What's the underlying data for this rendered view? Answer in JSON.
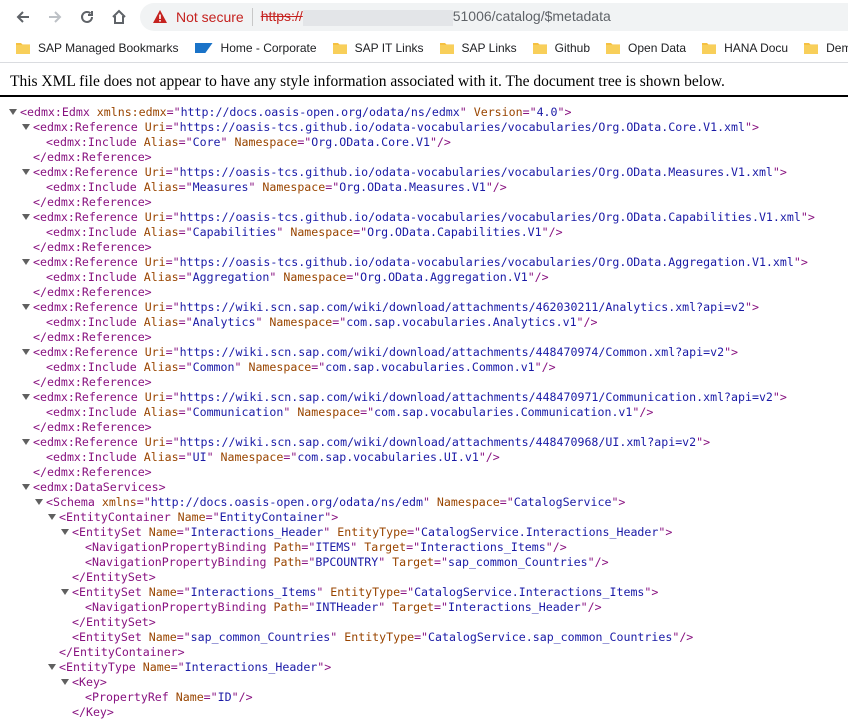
{
  "toolbar": {
    "not_secure": "Not secure",
    "url_scheme": "https://",
    "url_rest": "51006/catalog/$metadata"
  },
  "bookmarks": [
    {
      "label": "SAP Managed Bookmarks",
      "icon": "folder-icon"
    },
    {
      "label": "Home - Corporate",
      "icon": "sap-logo-icon"
    },
    {
      "label": "SAP IT Links",
      "icon": "folder-icon"
    },
    {
      "label": "SAP Links",
      "icon": "folder-icon"
    },
    {
      "label": "Github",
      "icon": "folder-icon"
    },
    {
      "label": "Open Data",
      "icon": "folder-icon"
    },
    {
      "label": "HANA Docu",
      "icon": "folder-icon"
    },
    {
      "label": "Dem",
      "icon": "folder-icon"
    }
  ],
  "notice": "This XML file does not appear to have any style information associated with it. The document tree is shown below.",
  "xml_lines": [
    {
      "i": 0,
      "t": true,
      "p": [
        [
          "tag",
          "<edmx:Edmx "
        ],
        [
          "attr",
          "xmlns:edmx"
        ],
        [
          "tag",
          "=\""
        ],
        [
          "val",
          "http://docs.oasis-open.org/odata/ns/edmx"
        ],
        [
          "tag",
          "\" "
        ],
        [
          "attr",
          "Version"
        ],
        [
          "tag",
          "=\""
        ],
        [
          "val",
          "4.0"
        ],
        [
          "tag",
          "\">"
        ]
      ]
    },
    {
      "i": 1,
      "t": true,
      "p": [
        [
          "tag",
          "<edmx:Reference "
        ],
        [
          "attr",
          "Uri"
        ],
        [
          "tag",
          "=\""
        ],
        [
          "val",
          "https://oasis-tcs.github.io/odata-vocabularies/vocabularies/Org.OData.Core.V1.xml"
        ],
        [
          "tag",
          "\">"
        ]
      ]
    },
    {
      "i": 2,
      "t": false,
      "p": [
        [
          "tag",
          "<edmx:Include "
        ],
        [
          "attr",
          "Alias"
        ],
        [
          "tag",
          "=\""
        ],
        [
          "val",
          "Core"
        ],
        [
          "tag",
          "\" "
        ],
        [
          "attr",
          "Namespace"
        ],
        [
          "tag",
          "=\""
        ],
        [
          "val",
          "Org.OData.Core.V1"
        ],
        [
          "tag",
          "\"/>"
        ]
      ]
    },
    {
      "i": 1,
      "t": false,
      "p": [
        [
          "tag",
          "</edmx:Reference>"
        ]
      ]
    },
    {
      "i": 1,
      "t": true,
      "p": [
        [
          "tag",
          "<edmx:Reference "
        ],
        [
          "attr",
          "Uri"
        ],
        [
          "tag",
          "=\""
        ],
        [
          "val",
          "https://oasis-tcs.github.io/odata-vocabularies/vocabularies/Org.OData.Measures.V1.xml"
        ],
        [
          "tag",
          "\">"
        ]
      ]
    },
    {
      "i": 2,
      "t": false,
      "p": [
        [
          "tag",
          "<edmx:Include "
        ],
        [
          "attr",
          "Alias"
        ],
        [
          "tag",
          "=\""
        ],
        [
          "val",
          "Measures"
        ],
        [
          "tag",
          "\" "
        ],
        [
          "attr",
          "Namespace"
        ],
        [
          "tag",
          "=\""
        ],
        [
          "val",
          "Org.OData.Measures.V1"
        ],
        [
          "tag",
          "\"/>"
        ]
      ]
    },
    {
      "i": 1,
      "t": false,
      "p": [
        [
          "tag",
          "</edmx:Reference>"
        ]
      ]
    },
    {
      "i": 1,
      "t": true,
      "p": [
        [
          "tag",
          "<edmx:Reference "
        ],
        [
          "attr",
          "Uri"
        ],
        [
          "tag",
          "=\""
        ],
        [
          "val",
          "https://oasis-tcs.github.io/odata-vocabularies/vocabularies/Org.OData.Capabilities.V1.xml"
        ],
        [
          "tag",
          "\">"
        ]
      ]
    },
    {
      "i": 2,
      "t": false,
      "p": [
        [
          "tag",
          "<edmx:Include "
        ],
        [
          "attr",
          "Alias"
        ],
        [
          "tag",
          "=\""
        ],
        [
          "val",
          "Capabilities"
        ],
        [
          "tag",
          "\" "
        ],
        [
          "attr",
          "Namespace"
        ],
        [
          "tag",
          "=\""
        ],
        [
          "val",
          "Org.OData.Capabilities.V1"
        ],
        [
          "tag",
          "\"/>"
        ]
      ]
    },
    {
      "i": 1,
      "t": false,
      "p": [
        [
          "tag",
          "</edmx:Reference>"
        ]
      ]
    },
    {
      "i": 1,
      "t": true,
      "p": [
        [
          "tag",
          "<edmx:Reference "
        ],
        [
          "attr",
          "Uri"
        ],
        [
          "tag",
          "=\""
        ],
        [
          "val",
          "https://oasis-tcs.github.io/odata-vocabularies/vocabularies/Org.OData.Aggregation.V1.xml"
        ],
        [
          "tag",
          "\">"
        ]
      ]
    },
    {
      "i": 2,
      "t": false,
      "p": [
        [
          "tag",
          "<edmx:Include "
        ],
        [
          "attr",
          "Alias"
        ],
        [
          "tag",
          "=\""
        ],
        [
          "val",
          "Aggregation"
        ],
        [
          "tag",
          "\" "
        ],
        [
          "attr",
          "Namespace"
        ],
        [
          "tag",
          "=\""
        ],
        [
          "val",
          "Org.OData.Aggregation.V1"
        ],
        [
          "tag",
          "\"/>"
        ]
      ]
    },
    {
      "i": 1,
      "t": false,
      "p": [
        [
          "tag",
          "</edmx:Reference>"
        ]
      ]
    },
    {
      "i": 1,
      "t": true,
      "p": [
        [
          "tag",
          "<edmx:Reference "
        ],
        [
          "attr",
          "Uri"
        ],
        [
          "tag",
          "=\""
        ],
        [
          "val",
          "https://wiki.scn.sap.com/wiki/download/attachments/462030211/Analytics.xml?api=v2"
        ],
        [
          "tag",
          "\">"
        ]
      ]
    },
    {
      "i": 2,
      "t": false,
      "p": [
        [
          "tag",
          "<edmx:Include "
        ],
        [
          "attr",
          "Alias"
        ],
        [
          "tag",
          "=\""
        ],
        [
          "val",
          "Analytics"
        ],
        [
          "tag",
          "\" "
        ],
        [
          "attr",
          "Namespace"
        ],
        [
          "tag",
          "=\""
        ],
        [
          "val",
          "com.sap.vocabularies.Analytics.v1"
        ],
        [
          "tag",
          "\"/>"
        ]
      ]
    },
    {
      "i": 1,
      "t": false,
      "p": [
        [
          "tag",
          "</edmx:Reference>"
        ]
      ]
    },
    {
      "i": 1,
      "t": true,
      "p": [
        [
          "tag",
          "<edmx:Reference "
        ],
        [
          "attr",
          "Uri"
        ],
        [
          "tag",
          "=\""
        ],
        [
          "val",
          "https://wiki.scn.sap.com/wiki/download/attachments/448470974/Common.xml?api=v2"
        ],
        [
          "tag",
          "\">"
        ]
      ]
    },
    {
      "i": 2,
      "t": false,
      "p": [
        [
          "tag",
          "<edmx:Include "
        ],
        [
          "attr",
          "Alias"
        ],
        [
          "tag",
          "=\""
        ],
        [
          "val",
          "Common"
        ],
        [
          "tag",
          "\" "
        ],
        [
          "attr",
          "Namespace"
        ],
        [
          "tag",
          "=\""
        ],
        [
          "val",
          "com.sap.vocabularies.Common.v1"
        ],
        [
          "tag",
          "\"/>"
        ]
      ]
    },
    {
      "i": 1,
      "t": false,
      "p": [
        [
          "tag",
          "</edmx:Reference>"
        ]
      ]
    },
    {
      "i": 1,
      "t": true,
      "p": [
        [
          "tag",
          "<edmx:Reference "
        ],
        [
          "attr",
          "Uri"
        ],
        [
          "tag",
          "=\""
        ],
        [
          "val",
          "https://wiki.scn.sap.com/wiki/download/attachments/448470971/Communication.xml?api=v2"
        ],
        [
          "tag",
          "\">"
        ]
      ]
    },
    {
      "i": 2,
      "t": false,
      "p": [
        [
          "tag",
          "<edmx:Include "
        ],
        [
          "attr",
          "Alias"
        ],
        [
          "tag",
          "=\""
        ],
        [
          "val",
          "Communication"
        ],
        [
          "tag",
          "\" "
        ],
        [
          "attr",
          "Namespace"
        ],
        [
          "tag",
          "=\""
        ],
        [
          "val",
          "com.sap.vocabularies.Communication.v1"
        ],
        [
          "tag",
          "\"/>"
        ]
      ]
    },
    {
      "i": 1,
      "t": false,
      "p": [
        [
          "tag",
          "</edmx:Reference>"
        ]
      ]
    },
    {
      "i": 1,
      "t": true,
      "p": [
        [
          "tag",
          "<edmx:Reference "
        ],
        [
          "attr",
          "Uri"
        ],
        [
          "tag",
          "=\""
        ],
        [
          "val",
          "https://wiki.scn.sap.com/wiki/download/attachments/448470968/UI.xml?api=v2"
        ],
        [
          "tag",
          "\">"
        ]
      ]
    },
    {
      "i": 2,
      "t": false,
      "p": [
        [
          "tag",
          "<edmx:Include "
        ],
        [
          "attr",
          "Alias"
        ],
        [
          "tag",
          "=\""
        ],
        [
          "val",
          "UI"
        ],
        [
          "tag",
          "\" "
        ],
        [
          "attr",
          "Namespace"
        ],
        [
          "tag",
          "=\""
        ],
        [
          "val",
          "com.sap.vocabularies.UI.v1"
        ],
        [
          "tag",
          "\"/>"
        ]
      ]
    },
    {
      "i": 1,
      "t": false,
      "p": [
        [
          "tag",
          "</edmx:Reference>"
        ]
      ]
    },
    {
      "i": 1,
      "t": true,
      "p": [
        [
          "tag",
          "<edmx:DataServices>"
        ]
      ]
    },
    {
      "i": 2,
      "t": true,
      "p": [
        [
          "tag",
          "<Schema "
        ],
        [
          "attr",
          "xmlns"
        ],
        [
          "tag",
          "=\""
        ],
        [
          "val",
          "http://docs.oasis-open.org/odata/ns/edm"
        ],
        [
          "tag",
          "\" "
        ],
        [
          "attr",
          "Namespace"
        ],
        [
          "tag",
          "=\""
        ],
        [
          "val",
          "CatalogService"
        ],
        [
          "tag",
          "\">"
        ]
      ]
    },
    {
      "i": 3,
      "t": true,
      "p": [
        [
          "tag",
          "<EntityContainer "
        ],
        [
          "attr",
          "Name"
        ],
        [
          "tag",
          "=\""
        ],
        [
          "val",
          "EntityContainer"
        ],
        [
          "tag",
          "\">"
        ]
      ]
    },
    {
      "i": 4,
      "t": true,
      "p": [
        [
          "tag",
          "<EntitySet "
        ],
        [
          "attr",
          "Name"
        ],
        [
          "tag",
          "=\""
        ],
        [
          "val",
          "Interactions_Header"
        ],
        [
          "tag",
          "\" "
        ],
        [
          "attr",
          "EntityType"
        ],
        [
          "tag",
          "=\""
        ],
        [
          "val",
          "CatalogService.Interactions_Header"
        ],
        [
          "tag",
          "\">"
        ]
      ]
    },
    {
      "i": 5,
      "t": false,
      "p": [
        [
          "tag",
          "<NavigationPropertyBinding "
        ],
        [
          "attr",
          "Path"
        ],
        [
          "tag",
          "=\""
        ],
        [
          "val",
          "ITEMS"
        ],
        [
          "tag",
          "\" "
        ],
        [
          "attr",
          "Target"
        ],
        [
          "tag",
          "=\""
        ],
        [
          "val",
          "Interactions_Items"
        ],
        [
          "tag",
          "\"/>"
        ]
      ]
    },
    {
      "i": 5,
      "t": false,
      "p": [
        [
          "tag",
          "<NavigationPropertyBinding "
        ],
        [
          "attr",
          "Path"
        ],
        [
          "tag",
          "=\""
        ],
        [
          "val",
          "BPCOUNTRY"
        ],
        [
          "tag",
          "\" "
        ],
        [
          "attr",
          "Target"
        ],
        [
          "tag",
          "=\""
        ],
        [
          "val",
          "sap_common_Countries"
        ],
        [
          "tag",
          "\"/>"
        ]
      ]
    },
    {
      "i": 4,
      "t": false,
      "p": [
        [
          "tag",
          "</EntitySet>"
        ]
      ]
    },
    {
      "i": 4,
      "t": true,
      "p": [
        [
          "tag",
          "<EntitySet "
        ],
        [
          "attr",
          "Name"
        ],
        [
          "tag",
          "=\""
        ],
        [
          "val",
          "Interactions_Items"
        ],
        [
          "tag",
          "\" "
        ],
        [
          "attr",
          "EntityType"
        ],
        [
          "tag",
          "=\""
        ],
        [
          "val",
          "CatalogService.Interactions_Items"
        ],
        [
          "tag",
          "\">"
        ]
      ]
    },
    {
      "i": 5,
      "t": false,
      "p": [
        [
          "tag",
          "<NavigationPropertyBinding "
        ],
        [
          "attr",
          "Path"
        ],
        [
          "tag",
          "=\""
        ],
        [
          "val",
          "INTHeader"
        ],
        [
          "tag",
          "\" "
        ],
        [
          "attr",
          "Target"
        ],
        [
          "tag",
          "=\""
        ],
        [
          "val",
          "Interactions_Header"
        ],
        [
          "tag",
          "\"/>"
        ]
      ]
    },
    {
      "i": 4,
      "t": false,
      "p": [
        [
          "tag",
          "</EntitySet>"
        ]
      ]
    },
    {
      "i": 4,
      "t": false,
      "p": [
        [
          "tag",
          "<EntitySet "
        ],
        [
          "attr",
          "Name"
        ],
        [
          "tag",
          "=\""
        ],
        [
          "val",
          "sap_common_Countries"
        ],
        [
          "tag",
          "\" "
        ],
        [
          "attr",
          "EntityType"
        ],
        [
          "tag",
          "=\""
        ],
        [
          "val",
          "CatalogService.sap_common_Countries"
        ],
        [
          "tag",
          "\"/>"
        ]
      ]
    },
    {
      "i": 3,
      "t": false,
      "p": [
        [
          "tag",
          "</EntityContainer>"
        ]
      ]
    },
    {
      "i": 3,
      "t": true,
      "p": [
        [
          "tag",
          "<EntityType "
        ],
        [
          "attr",
          "Name"
        ],
        [
          "tag",
          "=\""
        ],
        [
          "val",
          "Interactions_Header"
        ],
        [
          "tag",
          "\">"
        ]
      ]
    },
    {
      "i": 4,
      "t": true,
      "p": [
        [
          "tag",
          "<Key>"
        ]
      ]
    },
    {
      "i": 5,
      "t": false,
      "p": [
        [
          "tag",
          "<PropertyRef "
        ],
        [
          "attr",
          "Name"
        ],
        [
          "tag",
          "=\""
        ],
        [
          "val",
          "ID"
        ],
        [
          "tag",
          "\"/>"
        ]
      ]
    },
    {
      "i": 4,
      "t": false,
      "p": [
        [
          "tag",
          "</Key>"
        ]
      ]
    }
  ]
}
